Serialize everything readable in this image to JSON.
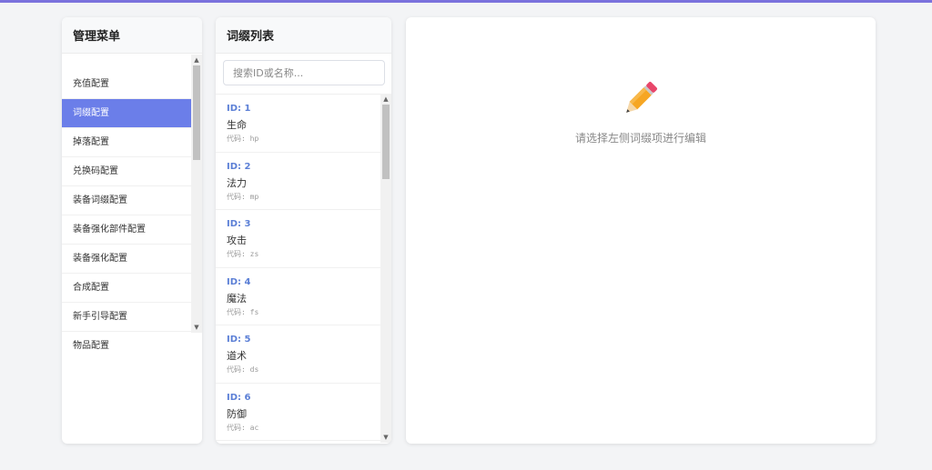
{
  "menu": {
    "title": "管理菜单",
    "items": [
      {
        "label": "充值配置",
        "active": false
      },
      {
        "label": "词缀配置",
        "active": true
      },
      {
        "label": "掉落配置",
        "active": false
      },
      {
        "label": "兑换码配置",
        "active": false
      },
      {
        "label": "装备词缀配置",
        "active": false
      },
      {
        "label": "装备强化部件配置",
        "active": false
      },
      {
        "label": "装备强化配置",
        "active": false
      },
      {
        "label": "合成配置",
        "active": false
      },
      {
        "label": "新手引导配置",
        "active": false
      },
      {
        "label": "物品配置",
        "active": false
      }
    ]
  },
  "affix": {
    "title": "词缀列表",
    "search_placeholder": "搜索ID或名称...",
    "items": [
      {
        "id": "ID: 1",
        "name": "生命",
        "code": "代码: hp"
      },
      {
        "id": "ID: 2",
        "name": "法力",
        "code": "代码: mp"
      },
      {
        "id": "ID: 3",
        "name": "攻击",
        "code": "代码: zs"
      },
      {
        "id": "ID: 4",
        "name": "魔法",
        "code": "代码: fs"
      },
      {
        "id": "ID: 5",
        "name": "道术",
        "code": "代码: ds"
      },
      {
        "id": "ID: 6",
        "name": "防御",
        "code": "代码: ac"
      }
    ]
  },
  "editor": {
    "empty_hint": "请选择左侧词缀项进行编辑"
  },
  "colors": {
    "accent": "#6b7ee9",
    "id_text": "#5b7fd6",
    "top_bar": "#7b72dd"
  }
}
